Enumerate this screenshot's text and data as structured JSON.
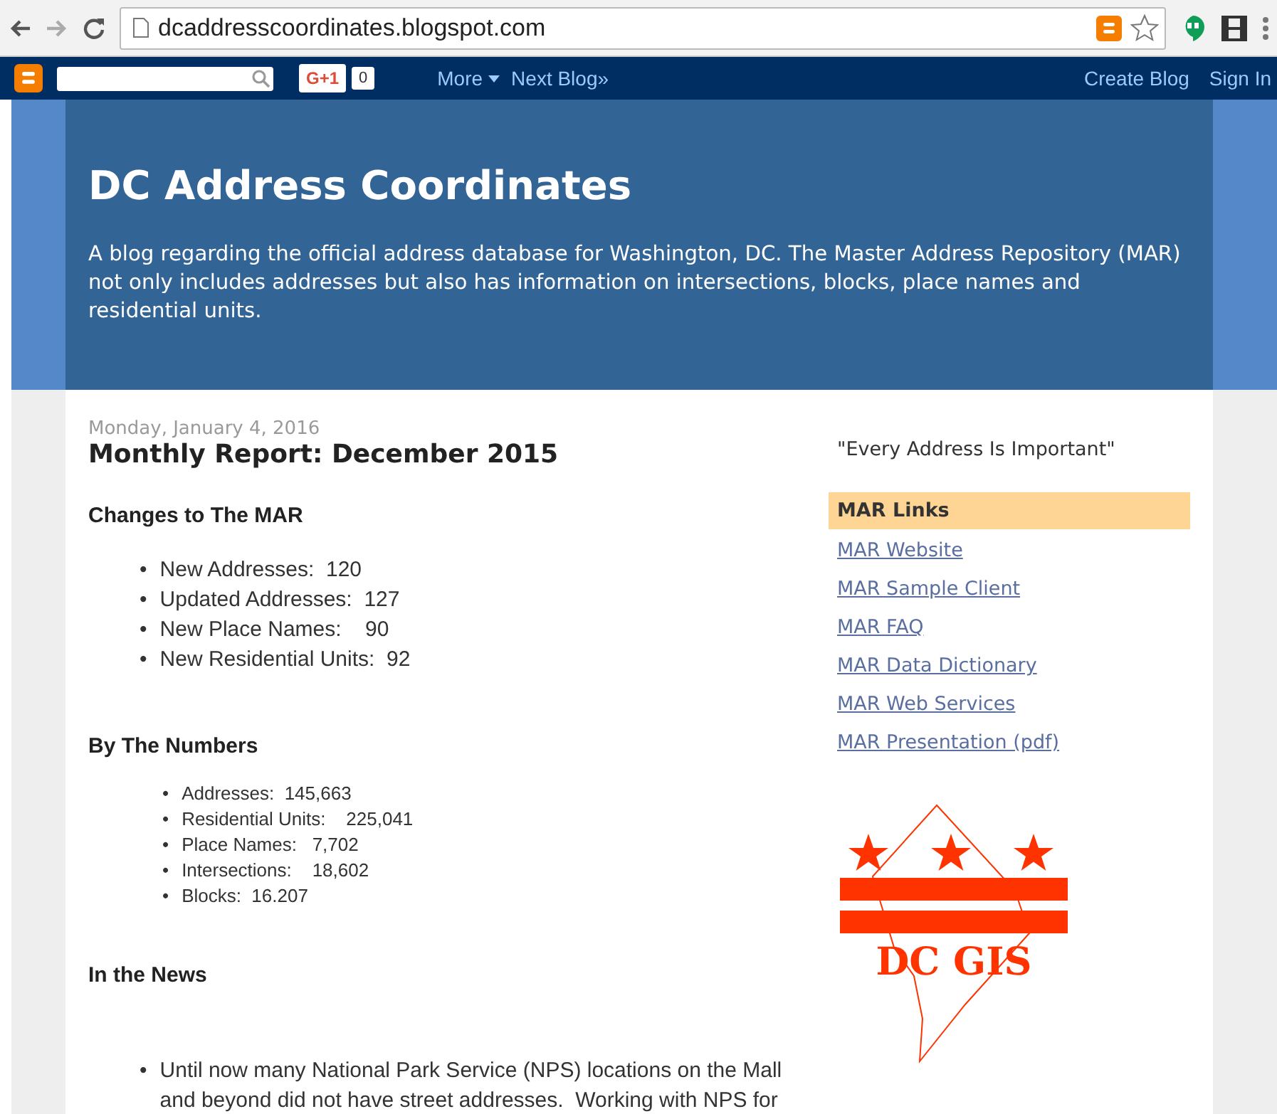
{
  "browser": {
    "url": "dcaddresscoordinates.blogspot.com"
  },
  "navbar": {
    "gplus": "G+1",
    "count": "0",
    "more": "More",
    "next": "Next Blog»",
    "create": "Create Blog",
    "sign_in": "Sign In"
  },
  "header": {
    "title": "DC Address Coordinates",
    "description": "A blog regarding the official address database for Washington, DC. The Master Address Repository (MAR) not only includes addresses but also has information on intersections, blocks, place names and residential units."
  },
  "post": {
    "date": "Monday, January 4, 2016",
    "title": "Monthly Report: December 2015",
    "sections": [
      {
        "heading": "Changes to The MAR",
        "kind": "regular",
        "bullet": "•",
        "items": [
          "New Addresses:  120",
          "Updated Addresses:  127",
          "New Place Names:    90",
          "New Residential Units:  92"
        ]
      },
      {
        "heading": "By The Numbers",
        "kind": "compact",
        "bullet": "•",
        "items": [
          "Addresses:  145,663",
          "Residential Units:    225,041",
          "Place Names:   7,702",
          "Intersections:    18,602",
          "Blocks:  16.207"
        ]
      },
      {
        "heading": "In the News",
        "kind": "spaced",
        "bullet": "•",
        "items": [
          "Until now many National Park Service (NPS) locations on the Mall and beyond did not have street addresses.  Working with NPS for"
        ]
      }
    ]
  },
  "sidebar": {
    "quote": "\"Every Address Is Important\"",
    "links_title": "MAR Links",
    "links": [
      "MAR Website",
      "MAR Sample Client",
      "MAR FAQ",
      "MAR Data Dictionary",
      "MAR Web Services",
      "MAR Presentation (pdf)"
    ],
    "logo": {
      "text": "DC GIS"
    }
  }
}
